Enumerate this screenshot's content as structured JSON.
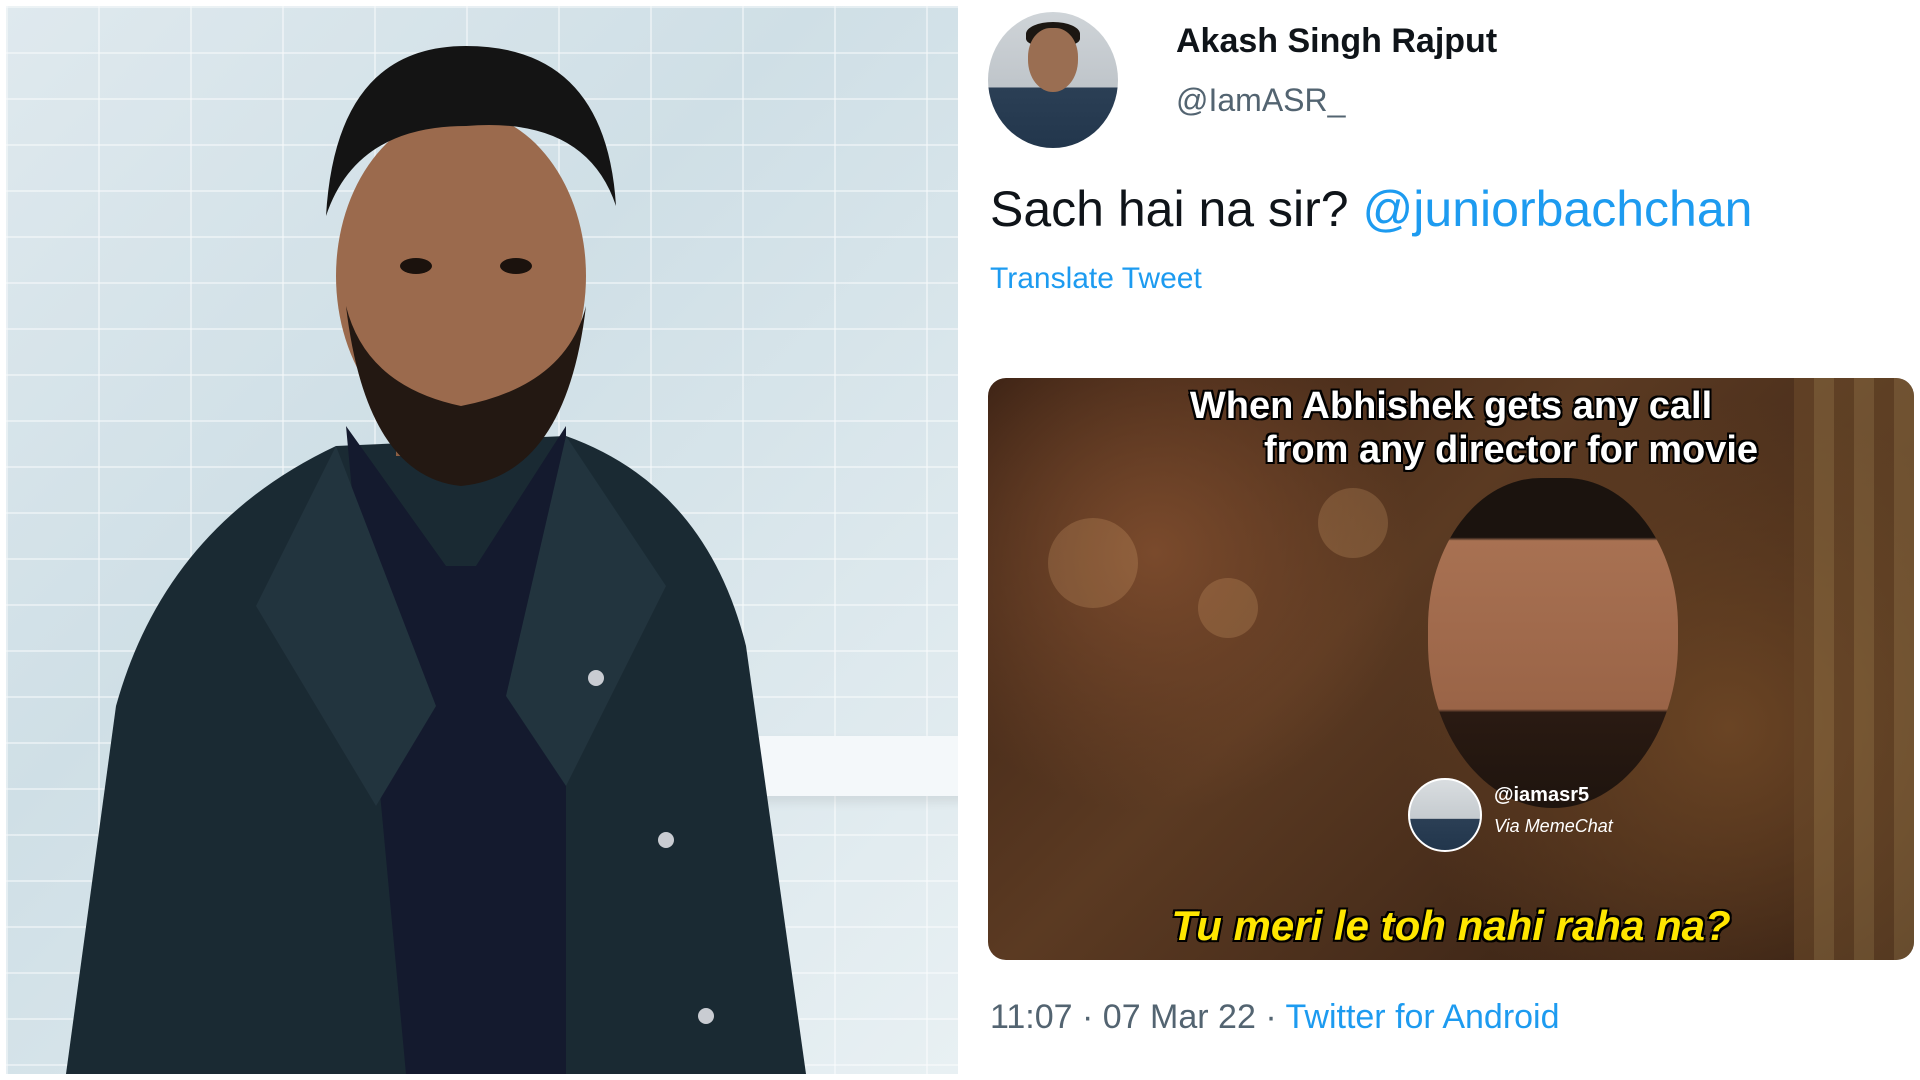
{
  "tweet": {
    "display_name": "Akash Singh Rajput",
    "handle": "@IamASR_",
    "text": "Sach hai na sir?",
    "mention": "@juniorbachchan",
    "translate_label": "Translate Tweet",
    "time": "11:07",
    "date": "07 Mar 22",
    "source": "Twitter for Android"
  },
  "meme": {
    "top_caption_line1": "When Abhishek gets any call",
    "top_caption_line2": "from any director for movie",
    "bottom_caption": "Tu meri le toh nahi raha na?",
    "watermark_handle": "@iamasr5",
    "watermark_via": "Via MemeChat"
  },
  "colors": {
    "link": "#1d9bf0",
    "text": "#0f1419",
    "secondary": "#536471",
    "meme_caption": "#ffe600"
  }
}
